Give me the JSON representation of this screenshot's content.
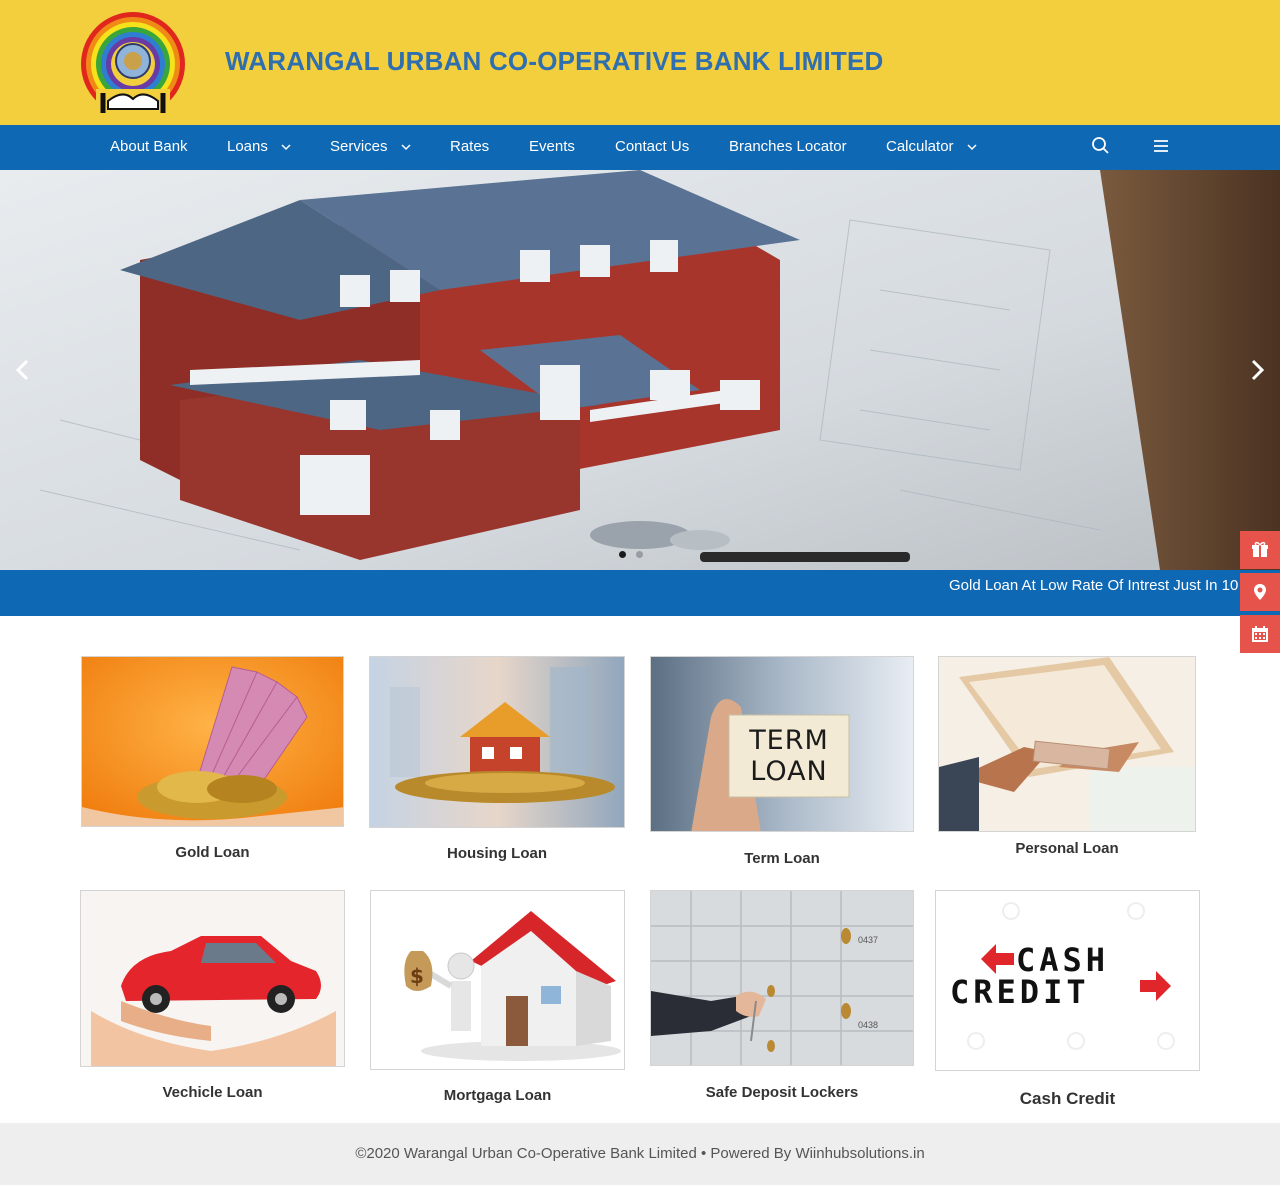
{
  "header": {
    "title": "WARANGAL URBAN CO-OPERATIVE BANK LIMITED"
  },
  "nav": {
    "items": [
      {
        "label": "About Bank",
        "has_dropdown": false
      },
      {
        "label": "Loans",
        "has_dropdown": true
      },
      {
        "label": "Services",
        "has_dropdown": true
      },
      {
        "label": "Rates",
        "has_dropdown": false
      },
      {
        "label": "Events",
        "has_dropdown": false
      },
      {
        "label": "Contact Us",
        "has_dropdown": false
      },
      {
        "label": "Branches Locator",
        "has_dropdown": false
      },
      {
        "label": "Calculator",
        "has_dropdown": true
      }
    ],
    "search_icon": "search-icon",
    "menu_icon": "hamburger-icon"
  },
  "slider": {
    "prev_icon": "chevron-left-icon",
    "next_icon": "chevron-right-icon",
    "active_slide": 1
  },
  "ticker": {
    "text": "Gold Loan At Low Rate Of Intrest Just In 10"
  },
  "side_buttons": [
    {
      "icon": "gift-icon"
    },
    {
      "icon": "map-pin-icon"
    },
    {
      "icon": "calendar-icon"
    }
  ],
  "cards": [
    {
      "label": "Gold Loan"
    },
    {
      "label": "Housing Loan"
    },
    {
      "label": "Term Loan",
      "image_text_1": "TERM",
      "image_text_2": "LOAN"
    },
    {
      "label": "Personal Loan"
    },
    {
      "label": "Vechicle Loan"
    },
    {
      "label": "Mortgaga Loan"
    },
    {
      "label": "Safe Deposit Lockers",
      "locker_1": "0437",
      "locker_2": "0438"
    },
    {
      "label": "Cash Credit",
      "image_text_1": "CASH",
      "image_text_2": "CREDIT"
    }
  ],
  "footer": {
    "text": "©2020 Warangal Urban Co-Operative Bank Limited • Powered By Wiinhubsolutions.in"
  },
  "colors": {
    "header_bg": "#f3cf3e",
    "nav_bg": "#0e68b4",
    "title": "#2f6fb0",
    "side_button": "#e5534b",
    "footer_bg": "#eeeeee"
  }
}
